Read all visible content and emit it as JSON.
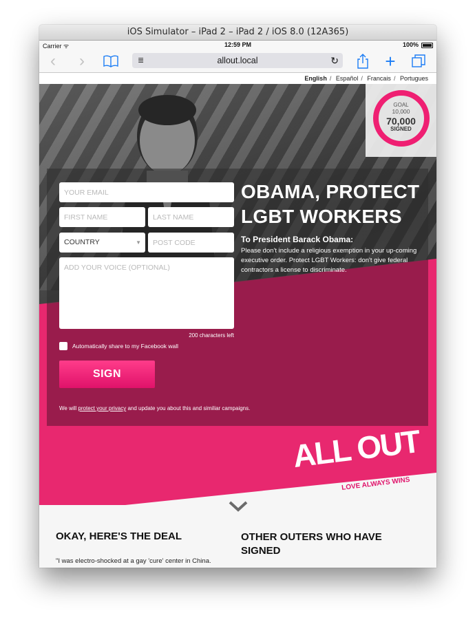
{
  "window": {
    "title": "iOS Simulator – iPad 2 – iPad 2 / iOS 8.0 (12A365)"
  },
  "status_bar": {
    "carrier": "Carrier",
    "time": "12:59 PM",
    "battery": "100%"
  },
  "browser": {
    "url": "allout.local"
  },
  "languages": [
    {
      "label": "English",
      "active": true
    },
    {
      "label": "Español"
    },
    {
      "label": "Francais"
    },
    {
      "label": "Portugues"
    }
  ],
  "goal_widget": {
    "goal_label": "GOAL",
    "goal_value": "10,000",
    "signed_value": "70,000",
    "signed_label": "SIGNED",
    "progress": 1.0
  },
  "form": {
    "email_placeholder": "YOUR EMAIL",
    "first_name_placeholder": "FIRST NAME",
    "last_name_placeholder": "LAST NAME",
    "country_value": "COUNTRY",
    "post_code_placeholder": "POST CODE",
    "voice_placeholder": "ADD YOUR VOICE (OPTIONAL)",
    "chars_left": "200 characters left",
    "facebook_share_label": "Automatically share to my Facebook wall",
    "facebook_share_checked": false,
    "sign_label": "SIGN",
    "privacy_prefix": "We will ",
    "privacy_link": "protect your privacy",
    "privacy_suffix": " and update you about this and similiar campaigns."
  },
  "campaign": {
    "headline_line1": "OBAMA, PROTECT",
    "headline_line2": "LGBT WORKERS",
    "to_line": "To President Barack Obama:",
    "petition_text": "Please don't include a religious exemption in your up-coming executive order. Protect LGBT Workers: don't give federal contractors a license to discriminate."
  },
  "brand": {
    "logo_text": "ALL OUT",
    "tagline": "LOVE ALWAYS WINS"
  },
  "sections": {
    "deal_title": "OKAY, HERE'S THE DEAL",
    "outers_title": "OTHER OUTERS WHO HAVE SIGNED",
    "quote_start": "\"I was electro-shocked at a gay 'cure' center in China."
  },
  "colors": {
    "accent_pink": "#e8286f",
    "deep_magenta": "#9b1b4c",
    "system_blue": "#1a7cf5"
  }
}
